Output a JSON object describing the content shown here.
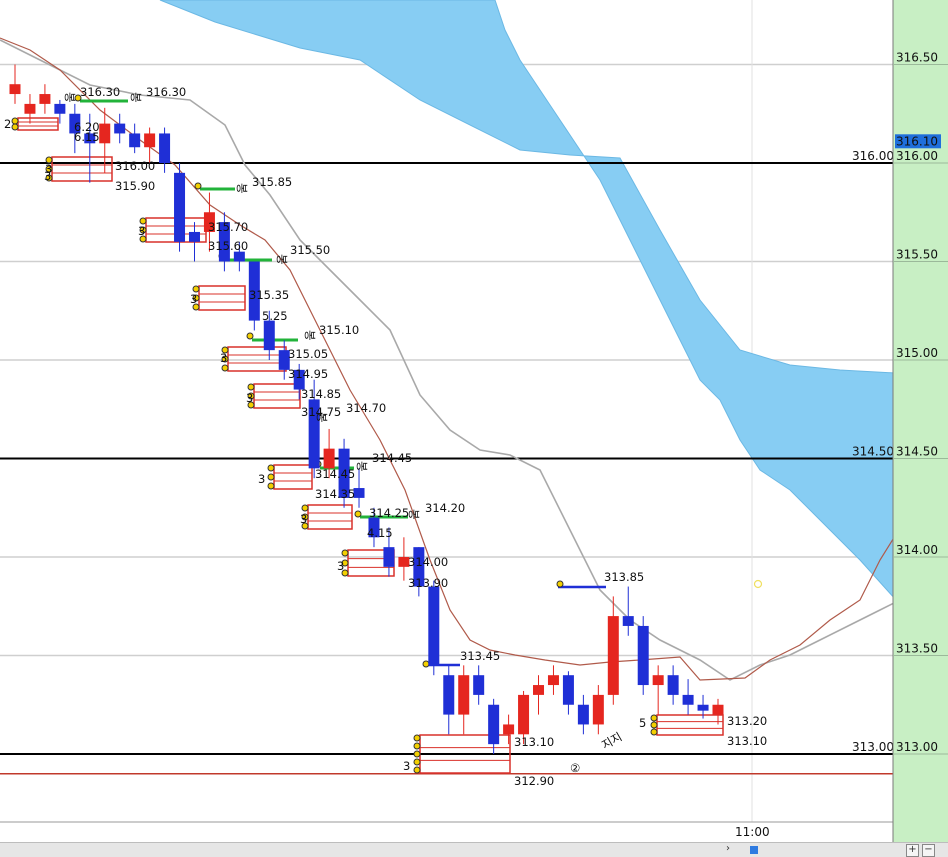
{
  "chart_data": {
    "type": "candlestick",
    "y_axis": {
      "ticks": [
        "316.50",
        "316.00",
        "315.50",
        "315.00",
        "314.50",
        "314.00",
        "313.50",
        "313.00"
      ],
      "current_price": "316.10",
      "range": [
        312.6,
        316.8
      ]
    },
    "x_axis": {
      "time_label": "11:00"
    },
    "horizontal_lines": [
      {
        "value": 316.0,
        "label": "316.00",
        "color": "#000000"
      },
      {
        "value": 314.5,
        "label": "314.50",
        "color": "#000000"
      },
      {
        "value": 313.0,
        "label": "313.00",
        "color": "#000000"
      },
      {
        "value": 312.9,
        "label": "",
        "color": "#c0392b"
      }
    ],
    "grid": true,
    "candles": [
      {
        "o": 316.4,
        "h": 316.5,
        "l": 316.3,
        "c": 316.35,
        "color": "red"
      },
      {
        "o": 316.3,
        "h": 316.35,
        "l": 316.2,
        "c": 316.25,
        "color": "red"
      },
      {
        "o": 316.35,
        "h": 316.4,
        "l": 316.25,
        "c": 316.3,
        "color": "red"
      },
      {
        "o": 316.3,
        "h": 316.32,
        "l": 316.2,
        "c": 316.25,
        "color": "blue"
      },
      {
        "o": 316.25,
        "h": 316.3,
        "l": 316.05,
        "c": 316.15,
        "color": "blue"
      },
      {
        "o": 316.15,
        "h": 316.25,
        "l": 315.9,
        "c": 316.1,
        "color": "blue"
      },
      {
        "o": 316.1,
        "h": 316.28,
        "l": 315.95,
        "c": 316.2,
        "color": "red"
      },
      {
        "o": 316.2,
        "h": 316.25,
        "l": 316.1,
        "c": 316.15,
        "color": "blue"
      },
      {
        "o": 316.15,
        "h": 316.2,
        "l": 316.05,
        "c": 316.08,
        "color": "blue"
      },
      {
        "o": 316.08,
        "h": 316.18,
        "l": 316.0,
        "c": 316.15,
        "color": "red"
      },
      {
        "o": 316.15,
        "h": 316.18,
        "l": 315.95,
        "c": 316.0,
        "color": "blue"
      },
      {
        "o": 315.95,
        "h": 316.0,
        "l": 315.55,
        "c": 315.6,
        "color": "blue"
      },
      {
        "o": 315.6,
        "h": 315.7,
        "l": 315.5,
        "c": 315.65,
        "color": "blue"
      },
      {
        "o": 315.65,
        "h": 315.85,
        "l": 315.55,
        "c": 315.75,
        "color": "red"
      },
      {
        "o": 315.7,
        "h": 315.75,
        "l": 315.45,
        "c": 315.5,
        "color": "blue"
      },
      {
        "o": 315.55,
        "h": 315.6,
        "l": 315.45,
        "c": 315.5,
        "color": "blue"
      },
      {
        "o": 315.5,
        "h": 315.5,
        "l": 315.15,
        "c": 315.2,
        "color": "blue"
      },
      {
        "o": 315.2,
        "h": 315.25,
        "l": 315.0,
        "c": 315.05,
        "color": "blue"
      },
      {
        "o": 315.05,
        "h": 315.1,
        "l": 314.9,
        "c": 314.95,
        "color": "blue"
      },
      {
        "o": 314.95,
        "h": 314.98,
        "l": 314.8,
        "c": 314.85,
        "color": "blue"
      },
      {
        "o": 314.8,
        "h": 314.9,
        "l": 314.4,
        "c": 314.45,
        "color": "blue"
      },
      {
        "o": 314.45,
        "h": 314.65,
        "l": 314.4,
        "c": 314.55,
        "color": "red"
      },
      {
        "o": 314.55,
        "h": 314.6,
        "l": 314.25,
        "c": 314.3,
        "color": "blue"
      },
      {
        "o": 314.35,
        "h": 314.45,
        "l": 314.25,
        "c": 314.3,
        "color": "blue"
      },
      {
        "o": 314.2,
        "h": 314.25,
        "l": 314.05,
        "c": 314.1,
        "color": "blue"
      },
      {
        "o": 314.05,
        "h": 314.15,
        "l": 313.9,
        "c": 313.95,
        "color": "blue"
      },
      {
        "o": 313.95,
        "h": 314.1,
        "l": 313.88,
        "c": 314.0,
        "color": "red"
      },
      {
        "o": 314.05,
        "h": 314.05,
        "l": 313.8,
        "c": 313.85,
        "color": "blue"
      },
      {
        "o": 313.85,
        "h": 313.88,
        "l": 313.4,
        "c": 313.45,
        "color": "blue"
      },
      {
        "o": 313.4,
        "h": 313.45,
        "l": 313.1,
        "c": 313.2,
        "color": "blue"
      },
      {
        "o": 313.2,
        "h": 313.45,
        "l": 313.1,
        "c": 313.4,
        "color": "red"
      },
      {
        "o": 313.4,
        "h": 313.45,
        "l": 313.25,
        "c": 313.3,
        "color": "blue"
      },
      {
        "o": 313.25,
        "h": 313.28,
        "l": 313.0,
        "c": 313.05,
        "color": "blue"
      },
      {
        "o": 313.1,
        "h": 313.2,
        "l": 313.05,
        "c": 313.15,
        "color": "red"
      },
      {
        "o": 313.1,
        "h": 313.32,
        "l": 313.05,
        "c": 313.3,
        "color": "red"
      },
      {
        "o": 313.3,
        "h": 313.4,
        "l": 313.2,
        "c": 313.35,
        "color": "red"
      },
      {
        "o": 313.4,
        "h": 313.45,
        "l": 313.3,
        "c": 313.35,
        "color": "red"
      },
      {
        "o": 313.4,
        "h": 313.42,
        "l": 313.2,
        "c": 313.25,
        "color": "blue"
      },
      {
        "o": 313.25,
        "h": 313.3,
        "l": 313.1,
        "c": 313.15,
        "color": "blue"
      },
      {
        "o": 313.15,
        "h": 313.35,
        "l": 313.1,
        "c": 313.3,
        "color": "red"
      },
      {
        "o": 313.3,
        "h": 313.8,
        "l": 313.25,
        "c": 313.7,
        "color": "red"
      },
      {
        "o": 313.7,
        "h": 313.85,
        "l": 313.6,
        "c": 313.65,
        "color": "blue"
      },
      {
        "o": 313.65,
        "h": 313.7,
        "l": 313.3,
        "c": 313.35,
        "color": "blue"
      },
      {
        "o": 313.35,
        "h": 313.45,
        "l": 313.2,
        "c": 313.4,
        "color": "red"
      },
      {
        "o": 313.4,
        "h": 313.45,
        "l": 313.25,
        "c": 313.3,
        "color": "blue"
      },
      {
        "o": 313.3,
        "h": 313.38,
        "l": 313.2,
        "c": 313.25,
        "color": "blue"
      },
      {
        "o": 313.25,
        "h": 313.3,
        "l": 313.18,
        "c": 313.22,
        "color": "blue"
      },
      {
        "o": 313.2,
        "h": 313.28,
        "l": 313.15,
        "c": 313.25,
        "color": "red"
      }
    ],
    "price_annotations": [
      "316.30",
      "316.30",
      "6.20",
      "6.15",
      "316.00",
      "315.90",
      "315.85",
      "315.70",
      "315.60",
      "315.50",
      "315.35",
      "5.25",
      "315.10",
      "315.05",
      "314.95",
      "314.85",
      "314.75",
      "314.70",
      "314.45",
      "314.45",
      "314.35",
      "314.25",
      "314.20",
      "4.15",
      "314.00",
      "313.90",
      "313.85",
      "313.45",
      "313.20",
      "313.10",
      "313.10",
      "312.90"
    ],
    "marker_labels": [
      "2",
      "3",
      "3",
      "3",
      "3",
      "3",
      "3",
      "3",
      "3",
      "3",
      "5",
      "3"
    ],
    "circled_marker": "②",
    "handwritten_note": "지지"
  }
}
